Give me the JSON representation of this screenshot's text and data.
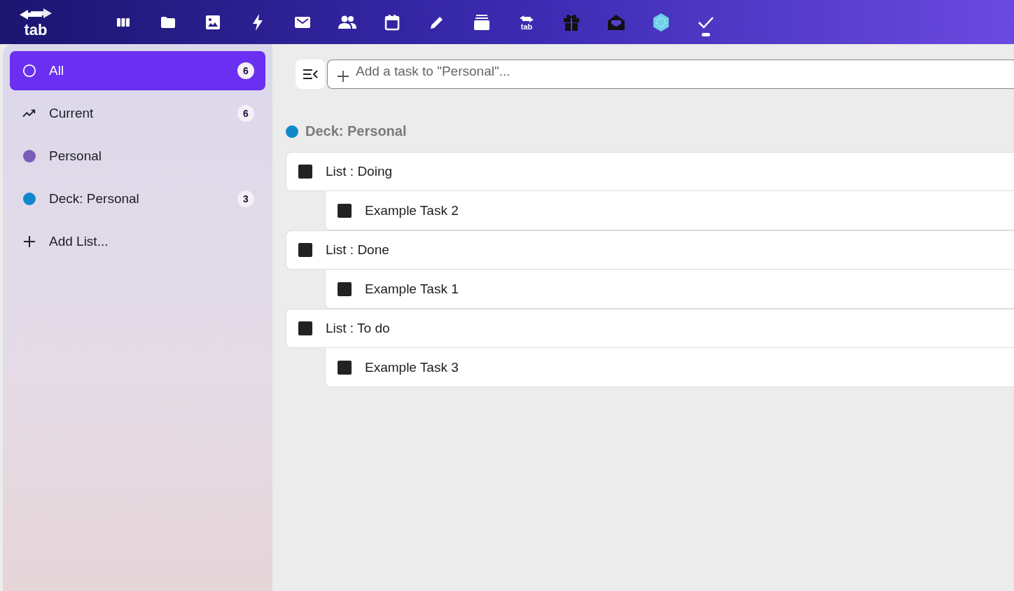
{
  "top_bar": {
    "logo": "tab",
    "apps": [
      {
        "kind": "columns",
        "selected": false
      },
      {
        "kind": "folder",
        "selected": false
      },
      {
        "kind": "image",
        "selected": false
      },
      {
        "kind": "bolt",
        "selected": false
      },
      {
        "kind": "mail",
        "selected": false
      },
      {
        "kind": "people",
        "selected": false
      },
      {
        "kind": "calendar",
        "selected": false
      },
      {
        "kind": "pencil",
        "selected": false
      },
      {
        "kind": "stack",
        "selected": false
      },
      {
        "kind": "tab",
        "label": "tab",
        "selected": false
      },
      {
        "kind": "gift",
        "selected": false
      },
      {
        "kind": "envelope-open",
        "selected": false
      },
      {
        "kind": "hexagon",
        "selected": false
      },
      {
        "kind": "check",
        "selected": true
      }
    ]
  },
  "sidebar": {
    "items": [
      {
        "kind": "all",
        "label": "All",
        "count": "6",
        "selected": true
      },
      {
        "kind": "trend",
        "label": "Current",
        "count": "6",
        "selected": false
      },
      {
        "kind": "list",
        "label": "Personal",
        "color": "#7b5cb8",
        "selected": false
      },
      {
        "kind": "list",
        "label": "Deck: Personal",
        "color": "#1188cc",
        "count": "3",
        "selected": false
      },
      {
        "kind": "add",
        "label": "Add List...",
        "selected": false
      }
    ]
  },
  "main": {
    "add_task": {
      "placeholder": "Add a task to \"Personal\"..."
    },
    "section": {
      "title": "Deck: Personal",
      "color": "#1188cc"
    },
    "rows": [
      {
        "kind": "list",
        "label": "List : Doing",
        "checked": false
      },
      {
        "kind": "task",
        "label": "Example Task 2",
        "checked": false
      },
      {
        "kind": "list",
        "label": "List : Done",
        "checked": false
      },
      {
        "kind": "task",
        "label": "Example Task 1",
        "checked": false
      },
      {
        "kind": "list",
        "label": "List : To do",
        "checked": false
      },
      {
        "kind": "task",
        "label": "Example Task 3",
        "checked": false
      }
    ]
  }
}
